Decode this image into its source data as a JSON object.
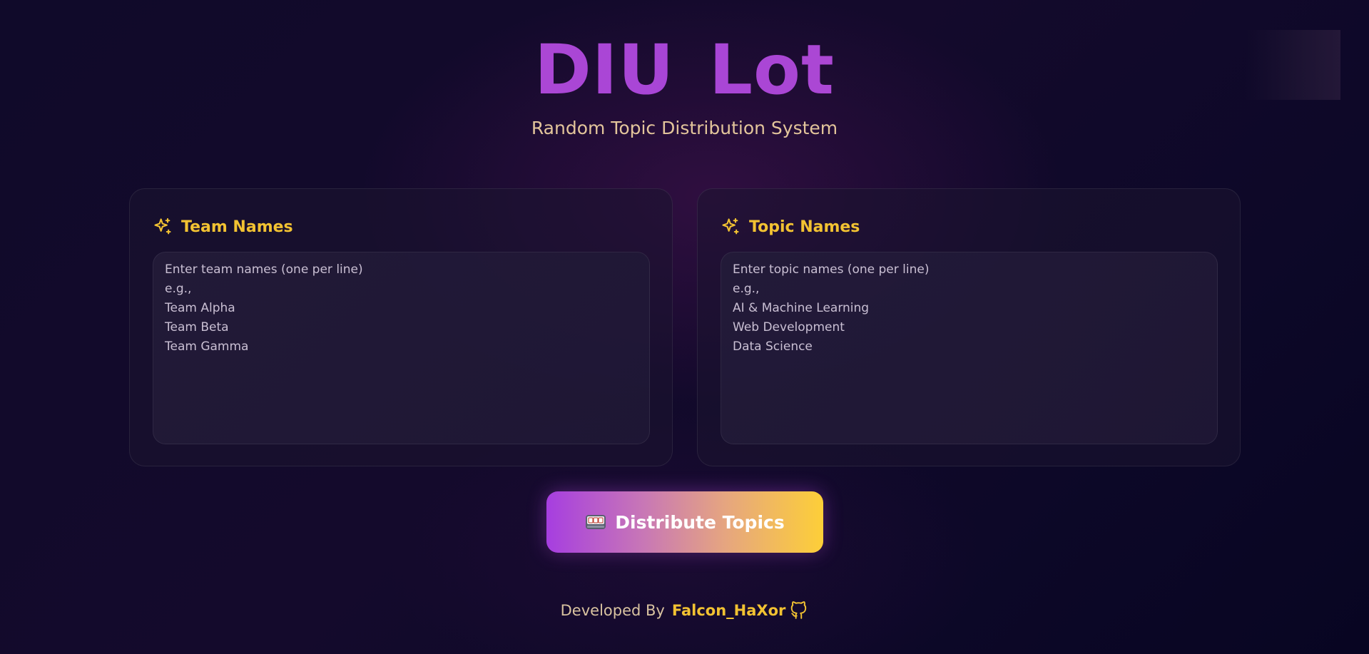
{
  "header": {
    "title": "DIU Lot",
    "subtitle": "Random Topic Distribution System"
  },
  "team_card": {
    "title": "Team Names",
    "icon": "sparkles-icon",
    "placeholder": "Enter team names (one per line)\ne.g.,\nTeam Alpha\nTeam Beta\nTeam Gamma"
  },
  "topic_card": {
    "title": "Topic Names",
    "icon": "sparkles-icon",
    "placeholder": "Enter topic names (one per line)\ne.g.,\nAI & Machine Learning\nWeb Development\nData Science"
  },
  "action": {
    "label": "Distribute Topics",
    "icon": "slot-machine-icon"
  },
  "footer": {
    "prefix": "Developed By",
    "author": "Falcon_HaXor",
    "icon": "github-icon"
  },
  "colors": {
    "title": "#b04ad0",
    "accent": "#f2c232",
    "subtitle": "#e3c59b",
    "button_start": "#a63ee0",
    "button_end": "#fdcf38"
  }
}
